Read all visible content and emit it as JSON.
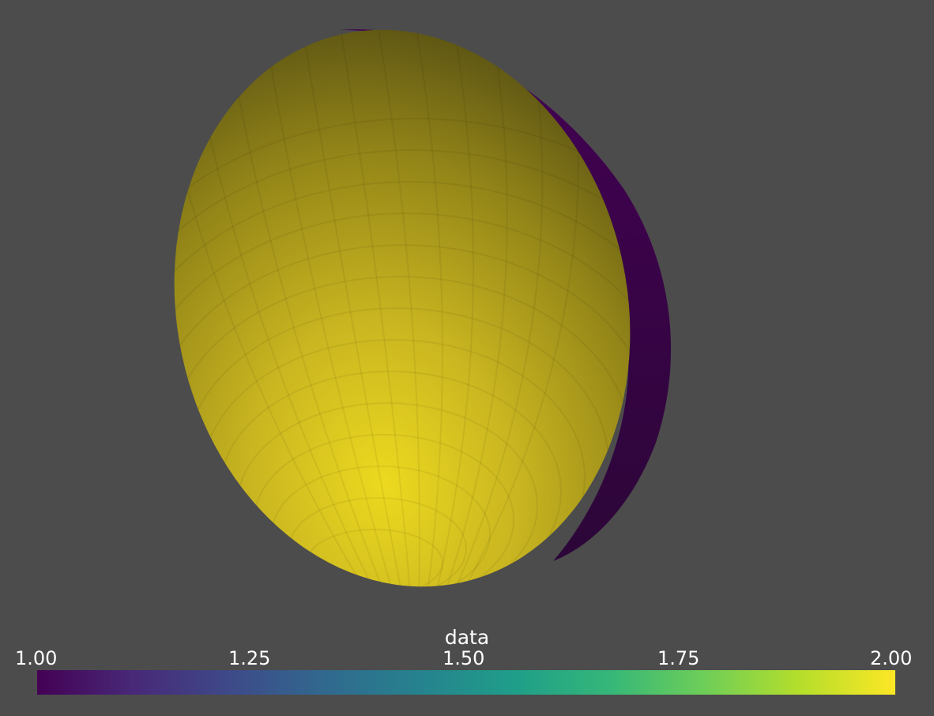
{
  "background_color": "#4c4c4c",
  "scene": {
    "object": "sphere",
    "cut_face_color": "#440154",
    "surface_color": "#fde725"
  },
  "scalar_bar": {
    "title": "data",
    "ticks": [
      "1.00",
      "1.25",
      "1.50",
      "1.75",
      "2.00"
    ],
    "range": [
      1.0,
      2.0
    ],
    "colormap": "viridis",
    "colormap_stops": [
      "#440154",
      "#482878",
      "#3e4989",
      "#31688e",
      "#26828e",
      "#1f9e89",
      "#35b779",
      "#6ece58",
      "#b5de2b",
      "#fde725"
    ]
  }
}
